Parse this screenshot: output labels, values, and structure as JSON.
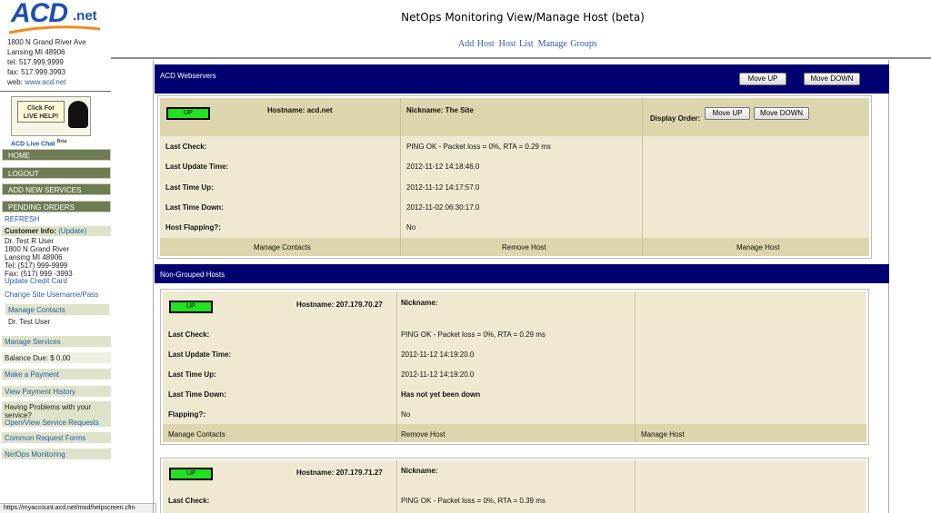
{
  "page": {
    "title": "NetOps Monitoring View/Manage Host (beta)"
  },
  "top_links": [
    "Add Host",
    "Host List",
    "Manage Groups"
  ],
  "logo": {
    "brand": "ACD",
    "tld": ".net"
  },
  "address": {
    "street": "1800 N Grand River Ave",
    "city": "Lansing MI 48906",
    "tel": "tel: 517.999.9999",
    "fax": "fax: 517.999.3993",
    "web_label": "web:",
    "web_link": "www.acd.net"
  },
  "chat": {
    "line1": "Click For",
    "line2": "LIVE HELP!",
    "label": "ACD Live Chat",
    "beta": "Beta"
  },
  "nav": {
    "home": "HOME",
    "logout": "LOGOUT",
    "add_services": "ADD NEW SERVICES",
    "pending_orders": "PENDING ORDERS",
    "refresh": "REFRESH"
  },
  "customer": {
    "heading": "Customer Info:",
    "update": "(Update)",
    "name": "Dr. Test R User",
    "street": "1800 N Grand River",
    "city": "Lansing MI 48906",
    "tel": "Tel: (517) 999-9999",
    "fax": "Fax: (517) 999 -3993",
    "update_cc": "Update Credit Card",
    "change_site": "Change Site Username/Pass",
    "manage_contacts": "Manage Contacts",
    "contact": "Dr. Test User"
  },
  "side_links": {
    "manage_services": "Manage Services",
    "balance": "Balance Due: $ 0.00",
    "make_payment": "Make a Payment",
    "payment_history": "View Payment History",
    "problems": "Having Problems with your service?",
    "service_requests": "Open/View Service Requests",
    "common_forms": "Common Request Forms",
    "netops": "NetOps Monitoring"
  },
  "status_bar": "https://myaccount.acd.net/mod/helpscreen.cfm",
  "groups": [
    {
      "name": "ACD Webservers",
      "move_up": "Move UP",
      "move_down": "Move DOWN",
      "hosts": [
        {
          "status": "UP",
          "hostname": "Hostname: acd.net",
          "nickname": "Nickname: The Site",
          "display_order": "Display Order:",
          "move_up": "Move UP",
          "move_down": "Move DOWN",
          "rows": [
            {
              "label": "Last Check:",
              "value": "PING OK - Packet loss = 0%, RTA = 0.29 ms"
            },
            {
              "label": "Last Update Time:",
              "value": "2012-11-12 14:18:46.0"
            },
            {
              "label": "Last Time Up:",
              "value": "2012-11-12 14:17:57.0"
            },
            {
              "label": "Last Time Down:",
              "value": "2012-11-02 06:30:17.0"
            },
            {
              "label": "Host Flapping?:",
              "value": "No"
            }
          ],
          "actions": [
            "Manage Contacts",
            "Remove Host",
            "Manage Host"
          ]
        }
      ]
    },
    {
      "name": "Non-Grouped Hosts",
      "hosts": [
        {
          "status": "UP",
          "hostname": "Hostname: 207.179.70.27",
          "nickname": "Nickname:",
          "rows": [
            {
              "label": "Last Check:",
              "value": "PING OK - Packet loss = 0%, RTA = 0.29 ms"
            },
            {
              "label": "Last Update Time:",
              "value": "2012-11-12 14:19:20.0"
            },
            {
              "label": "Last Time Up:",
              "value": "2012-11-12 14:19:20.0"
            },
            {
              "label": "Last Time Down:",
              "value": "Has not yet been down"
            },
            {
              "label": "Flapping?:",
              "value": "No"
            }
          ],
          "actions": [
            "Manage Contacts",
            "Remove Host",
            "Manage Host"
          ]
        },
        {
          "status": "UP",
          "hostname": "Hostname: 207.179.71.27",
          "nickname": "Nickname:",
          "rows": [
            {
              "label": "Last Check:",
              "value": "PING OK - Packet loss = 0%, RTA = 0.39 ms"
            }
          ]
        }
      ]
    }
  ],
  "colors": {
    "group_header": "#000070",
    "nav_button": "#6e7c54",
    "status_up": "#22e022",
    "card_tan": "#ddd5ad"
  }
}
